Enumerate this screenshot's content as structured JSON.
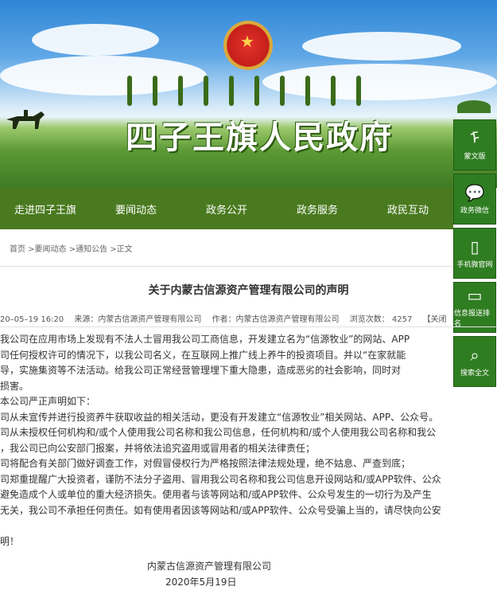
{
  "header": {
    "site_title": "四子王旗人民政府"
  },
  "nav": {
    "items": [
      "走进四子王旗",
      "要闻动态",
      "政务公开",
      "政务服务",
      "政民互动"
    ]
  },
  "side_panel": {
    "items": [
      {
        "icon": "mongolian-script-icon",
        "label": "蒙文版"
      },
      {
        "icon": "wechat-icon",
        "label": "政务微信"
      },
      {
        "icon": "mobile-icon",
        "label": "手机微官网"
      },
      {
        "icon": "monitor-icon",
        "label": "信息报送排名"
      },
      {
        "icon": "search-icon",
        "label": "搜索全文"
      }
    ]
  },
  "breadcrumb": "首页 >要闻动态 >通知公告 >正文",
  "article": {
    "title": "关于内蒙古信源资产管理有限公司的声明",
    "meta": {
      "date": "20–05–19 16:20",
      "source": "来源：内蒙古信源资产管理有限公司",
      "author": "作者：内蒙古信源资产管理有限公司",
      "views": "浏览次数： 4257",
      "close": "【关闭"
    },
    "lines": [
      "我公司在应用市场上发现有不法人士冒用我公司工商信息，开发建立名为“信源牧业”的网站、APP",
      "司任何授权许可的情况下，以我公司名义，在互联网上推广线上养牛的投资项目。并以“在家就能",
      "导，实施集资等不法活动。给我公司正常经营管理埋下重大隐患，造成恶劣的社会影响，同时对",
      "损害。",
      "本公司严正声明如下：",
      "司从未宣传并进行投资养牛获取收益的相关活动，更没有开发建立“信源牧业”相关网站、APP、公众号。",
      "司从未授权任何机构和/或个人使用我公司名称和我公司信息，任何机构和/或个人使用我公司名称和我公",
      "，我公司已向公安部门报案，并将依法追究盗用或冒用者的相关法律责任；",
      "司将配合有关部门做好调查工作，对假冒侵权行为严格按照法律法规处理，绝不姑息、严查到底；",
      "司郑重提醒广大投资者，谨防不法分子盗用、冒用我公司名称和我公司信息开设网站和/或APP软件、公众",
      "避免造成个人或单位的重大经济损失。使用者与该等网站和/或APP软件、公众号发生的一切行为及产生",
      "无关，我公司不承担任何责任。如有使用者因该等网站和/或APP软件、公众号受骗上当的，请尽快向公安",
      "",
      "明！"
    ],
    "signature": "内蒙古信源资产管理有限公司",
    "sign_date": "2020年5月19日"
  }
}
